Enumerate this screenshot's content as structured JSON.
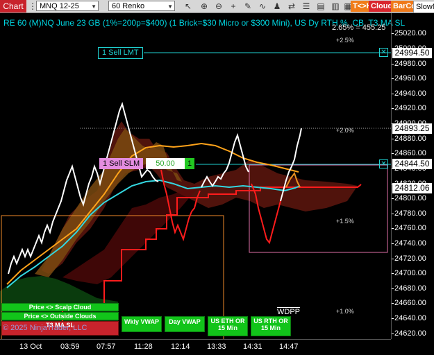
{
  "toolbar": {
    "chart_tab": "Chart",
    "instrument": "MNQ 12-25",
    "period": "60 Renko",
    "icons": [
      "instrument-selector-icon",
      "pointer-icon",
      "zoom-in-icon",
      "zoom-out-icon",
      "crosshair-icon",
      "drawing-tools-icon",
      "indicators-icon",
      "strategies-icon",
      "chart-trader-icon",
      "properties-icon",
      "data-box-icon",
      "templates-icon",
      "bar-type-icon"
    ],
    "tkk": "T<>K",
    "cloud": "Cloud",
    "barcol": "BarCol",
    "slowm": "SlowM"
  },
  "title": "RE 60 (M)NQ June 23 GB (1%=200p=$400) (1 Brick=$30 Micro or $300 Mini), US Dy RTH %, CB, T3 MA SL",
  "title_overlap": "2.65% = 455.25",
  "percent_labels": [
    "+2.5%",
    "+2.0%",
    "+1.5%",
    "+1.0%"
  ],
  "orders": {
    "sell_lmt_label": "1 Sell LMT",
    "sell_slm_label": "1 Sell SLM",
    "slm_value": "50.00",
    "slm_qty": "1",
    "close_glyph": "✕"
  },
  "price_axis": {
    "ticks": [
      "25020.00",
      "25000.00",
      "24980.00",
      "24960.00",
      "24940.00",
      "24920.00",
      "24900.00",
      "24880.00",
      "24860.00",
      "24840.00",
      "24820.00",
      "24800.00",
      "24780.00",
      "24760.00",
      "24740.00",
      "24720.00",
      "24700.00",
      "24680.00",
      "24660.00",
      "24640.00",
      "24620.00"
    ],
    "boxes": [
      "24994.50",
      "24893.25",
      "24844.50",
      "24812.06"
    ]
  },
  "time_axis": [
    "13 Oct",
    "03:59",
    "07:57",
    "11:28",
    "12:14",
    "13:33",
    "14:31",
    "14:47"
  ],
  "buttons": {
    "scalp_cloud": "Price <> Scalp Cloud",
    "outside_clouds": "Price <> Outside Clouds",
    "t3_ma_sl": "T3 MA SL",
    "wkly_vwap": "Wkly VWAP",
    "day_vwap": "Day VWAP",
    "us_eth_or": "US ETH OR 15 Min",
    "us_rth_or": "US RTH OR 15 Min"
  },
  "copyright": "© 2025 NinjaTrader, LLC",
  "wdpp": "WDPP",
  "colors": {
    "accent": "#00d5e0",
    "order_line": "#1fd0d0",
    "pink_box": "#e070a8",
    "orange_box": "#f08a2a",
    "red_line": "#ff1c1c",
    "t3_orange": "#ffa31a",
    "t3_cyan": "#33d7e0",
    "green_btn": "#12c41a"
  }
}
